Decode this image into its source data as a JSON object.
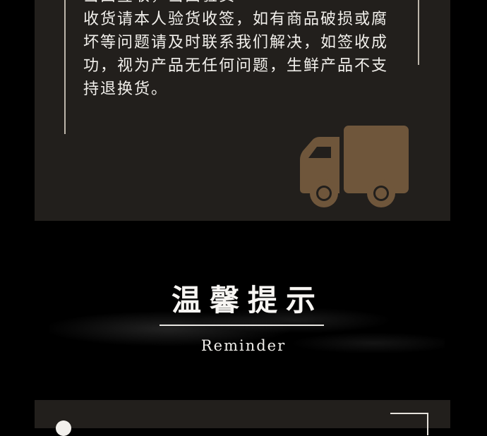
{
  "notice": {
    "lines": [
      "当面签收，当面验货",
      "收货请本人验货收签，如有商品破损或腐",
      "坏等问题请及时联系我们解决，如签收成",
      "功，视为产品无任何问题，生鲜产品不支",
      "持退换货。"
    ]
  },
  "icons": {
    "delivery_truck": "truck-icon",
    "truck_color": "#6f563b"
  },
  "section": {
    "title": "温馨提示",
    "subtitle": "Reminder"
  },
  "colors": {
    "background": "#000000",
    "card": "#221f1c",
    "text": "#f2f0ec"
  }
}
